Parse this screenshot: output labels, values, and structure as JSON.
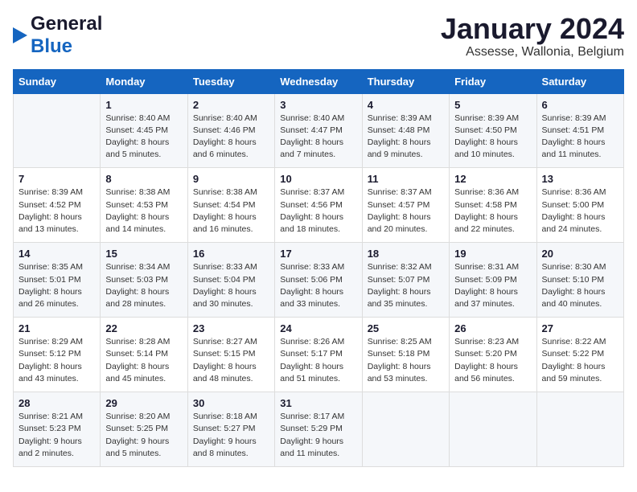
{
  "header": {
    "logo_general": "General",
    "logo_blue": "Blue",
    "month_title": "January 2024",
    "subtitle": "Assesse, Wallonia, Belgium"
  },
  "days_of_week": [
    "Sunday",
    "Monday",
    "Tuesday",
    "Wednesday",
    "Thursday",
    "Friday",
    "Saturday"
  ],
  "weeks": [
    [
      {
        "day": "",
        "sunrise": "",
        "sunset": "",
        "daylight": ""
      },
      {
        "day": "1",
        "sunrise": "Sunrise: 8:40 AM",
        "sunset": "Sunset: 4:45 PM",
        "daylight": "Daylight: 8 hours and 5 minutes."
      },
      {
        "day": "2",
        "sunrise": "Sunrise: 8:40 AM",
        "sunset": "Sunset: 4:46 PM",
        "daylight": "Daylight: 8 hours and 6 minutes."
      },
      {
        "day": "3",
        "sunrise": "Sunrise: 8:40 AM",
        "sunset": "Sunset: 4:47 PM",
        "daylight": "Daylight: 8 hours and 7 minutes."
      },
      {
        "day": "4",
        "sunrise": "Sunrise: 8:39 AM",
        "sunset": "Sunset: 4:48 PM",
        "daylight": "Daylight: 8 hours and 9 minutes."
      },
      {
        "day": "5",
        "sunrise": "Sunrise: 8:39 AM",
        "sunset": "Sunset: 4:50 PM",
        "daylight": "Daylight: 8 hours and 10 minutes."
      },
      {
        "day": "6",
        "sunrise": "Sunrise: 8:39 AM",
        "sunset": "Sunset: 4:51 PM",
        "daylight": "Daylight: 8 hours and 11 minutes."
      }
    ],
    [
      {
        "day": "7",
        "sunrise": "Sunrise: 8:39 AM",
        "sunset": "Sunset: 4:52 PM",
        "daylight": "Daylight: 8 hours and 13 minutes."
      },
      {
        "day": "8",
        "sunrise": "Sunrise: 8:38 AM",
        "sunset": "Sunset: 4:53 PM",
        "daylight": "Daylight: 8 hours and 14 minutes."
      },
      {
        "day": "9",
        "sunrise": "Sunrise: 8:38 AM",
        "sunset": "Sunset: 4:54 PM",
        "daylight": "Daylight: 8 hours and 16 minutes."
      },
      {
        "day": "10",
        "sunrise": "Sunrise: 8:37 AM",
        "sunset": "Sunset: 4:56 PM",
        "daylight": "Daylight: 8 hours and 18 minutes."
      },
      {
        "day": "11",
        "sunrise": "Sunrise: 8:37 AM",
        "sunset": "Sunset: 4:57 PM",
        "daylight": "Daylight: 8 hours and 20 minutes."
      },
      {
        "day": "12",
        "sunrise": "Sunrise: 8:36 AM",
        "sunset": "Sunset: 4:58 PM",
        "daylight": "Daylight: 8 hours and 22 minutes."
      },
      {
        "day": "13",
        "sunrise": "Sunrise: 8:36 AM",
        "sunset": "Sunset: 5:00 PM",
        "daylight": "Daylight: 8 hours and 24 minutes."
      }
    ],
    [
      {
        "day": "14",
        "sunrise": "Sunrise: 8:35 AM",
        "sunset": "Sunset: 5:01 PM",
        "daylight": "Daylight: 8 hours and 26 minutes."
      },
      {
        "day": "15",
        "sunrise": "Sunrise: 8:34 AM",
        "sunset": "Sunset: 5:03 PM",
        "daylight": "Daylight: 8 hours and 28 minutes."
      },
      {
        "day": "16",
        "sunrise": "Sunrise: 8:33 AM",
        "sunset": "Sunset: 5:04 PM",
        "daylight": "Daylight: 8 hours and 30 minutes."
      },
      {
        "day": "17",
        "sunrise": "Sunrise: 8:33 AM",
        "sunset": "Sunset: 5:06 PM",
        "daylight": "Daylight: 8 hours and 33 minutes."
      },
      {
        "day": "18",
        "sunrise": "Sunrise: 8:32 AM",
        "sunset": "Sunset: 5:07 PM",
        "daylight": "Daylight: 8 hours and 35 minutes."
      },
      {
        "day": "19",
        "sunrise": "Sunrise: 8:31 AM",
        "sunset": "Sunset: 5:09 PM",
        "daylight": "Daylight: 8 hours and 37 minutes."
      },
      {
        "day": "20",
        "sunrise": "Sunrise: 8:30 AM",
        "sunset": "Sunset: 5:10 PM",
        "daylight": "Daylight: 8 hours and 40 minutes."
      }
    ],
    [
      {
        "day": "21",
        "sunrise": "Sunrise: 8:29 AM",
        "sunset": "Sunset: 5:12 PM",
        "daylight": "Daylight: 8 hours and 43 minutes."
      },
      {
        "day": "22",
        "sunrise": "Sunrise: 8:28 AM",
        "sunset": "Sunset: 5:14 PM",
        "daylight": "Daylight: 8 hours and 45 minutes."
      },
      {
        "day": "23",
        "sunrise": "Sunrise: 8:27 AM",
        "sunset": "Sunset: 5:15 PM",
        "daylight": "Daylight: 8 hours and 48 minutes."
      },
      {
        "day": "24",
        "sunrise": "Sunrise: 8:26 AM",
        "sunset": "Sunset: 5:17 PM",
        "daylight": "Daylight: 8 hours and 51 minutes."
      },
      {
        "day": "25",
        "sunrise": "Sunrise: 8:25 AM",
        "sunset": "Sunset: 5:18 PM",
        "daylight": "Daylight: 8 hours and 53 minutes."
      },
      {
        "day": "26",
        "sunrise": "Sunrise: 8:23 AM",
        "sunset": "Sunset: 5:20 PM",
        "daylight": "Daylight: 8 hours and 56 minutes."
      },
      {
        "day": "27",
        "sunrise": "Sunrise: 8:22 AM",
        "sunset": "Sunset: 5:22 PM",
        "daylight": "Daylight: 8 hours and 59 minutes."
      }
    ],
    [
      {
        "day": "28",
        "sunrise": "Sunrise: 8:21 AM",
        "sunset": "Sunset: 5:23 PM",
        "daylight": "Daylight: 9 hours and 2 minutes."
      },
      {
        "day": "29",
        "sunrise": "Sunrise: 8:20 AM",
        "sunset": "Sunset: 5:25 PM",
        "daylight": "Daylight: 9 hours and 5 minutes."
      },
      {
        "day": "30",
        "sunrise": "Sunrise: 8:18 AM",
        "sunset": "Sunset: 5:27 PM",
        "daylight": "Daylight: 9 hours and 8 minutes."
      },
      {
        "day": "31",
        "sunrise": "Sunrise: 8:17 AM",
        "sunset": "Sunset: 5:29 PM",
        "daylight": "Daylight: 9 hours and 11 minutes."
      },
      {
        "day": "",
        "sunrise": "",
        "sunset": "",
        "daylight": ""
      },
      {
        "day": "",
        "sunrise": "",
        "sunset": "",
        "daylight": ""
      },
      {
        "day": "",
        "sunrise": "",
        "sunset": "",
        "daylight": ""
      }
    ]
  ]
}
